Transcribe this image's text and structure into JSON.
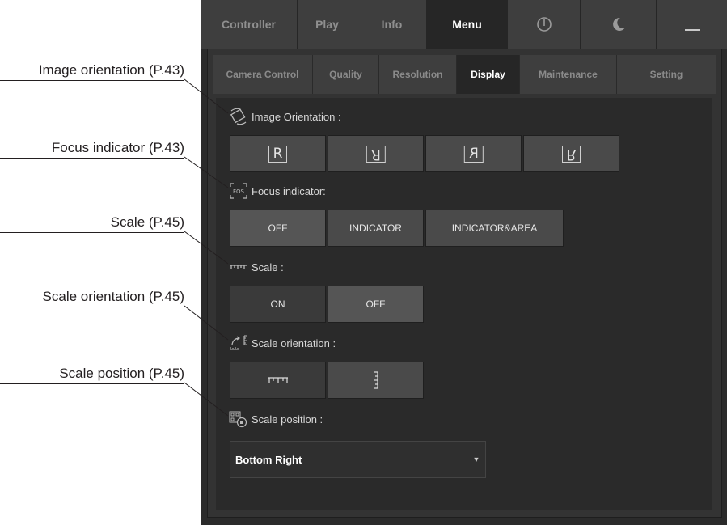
{
  "callouts": [
    {
      "text": "Image orientation (P.43)"
    },
    {
      "text": "Focus indicator (P.43)"
    },
    {
      "text": "Scale (P.45)"
    },
    {
      "text": "Scale orientation (P.45)"
    },
    {
      "text": "Scale position (P.45)"
    }
  ],
  "main_tabs": [
    {
      "label": "Controller"
    },
    {
      "label": "Play"
    },
    {
      "label": "Info"
    },
    {
      "label": "Menu",
      "active": true
    },
    {
      "icon": "power-icon"
    },
    {
      "icon": "moon-icon"
    },
    {
      "icon": "minimize-icon"
    }
  ],
  "sub_tabs": [
    {
      "label": "Camera Control"
    },
    {
      "label": "Quality"
    },
    {
      "label": "Resolution"
    },
    {
      "label": "Display",
      "active": true
    },
    {
      "label": "Maintenance"
    },
    {
      "label": "Setting"
    }
  ],
  "sections": {
    "image_orientation": {
      "label": "Image Orientation :",
      "options": [
        "R",
        "R",
        "R",
        "R"
      ]
    },
    "focus_indicator": {
      "label": "Focus indicator:",
      "options": [
        "OFF",
        "INDICATOR",
        "INDICATOR&AREA"
      ],
      "selected": "OFF"
    },
    "scale": {
      "label": "Scale :",
      "options": [
        "ON",
        "OFF"
      ],
      "selected": "ON"
    },
    "scale_orientation": {
      "label": "Scale orientation :",
      "options": [
        "horizontal-scale-icon",
        "vertical-scale-icon"
      ]
    },
    "scale_position": {
      "label": "Scale position :",
      "value": "Bottom Right"
    }
  },
  "colors": {
    "window_bg": "#2b2b2b",
    "tab_inactive": "#3e3e3e",
    "tab_active": "#262626",
    "button": "#4a4a4a"
  }
}
